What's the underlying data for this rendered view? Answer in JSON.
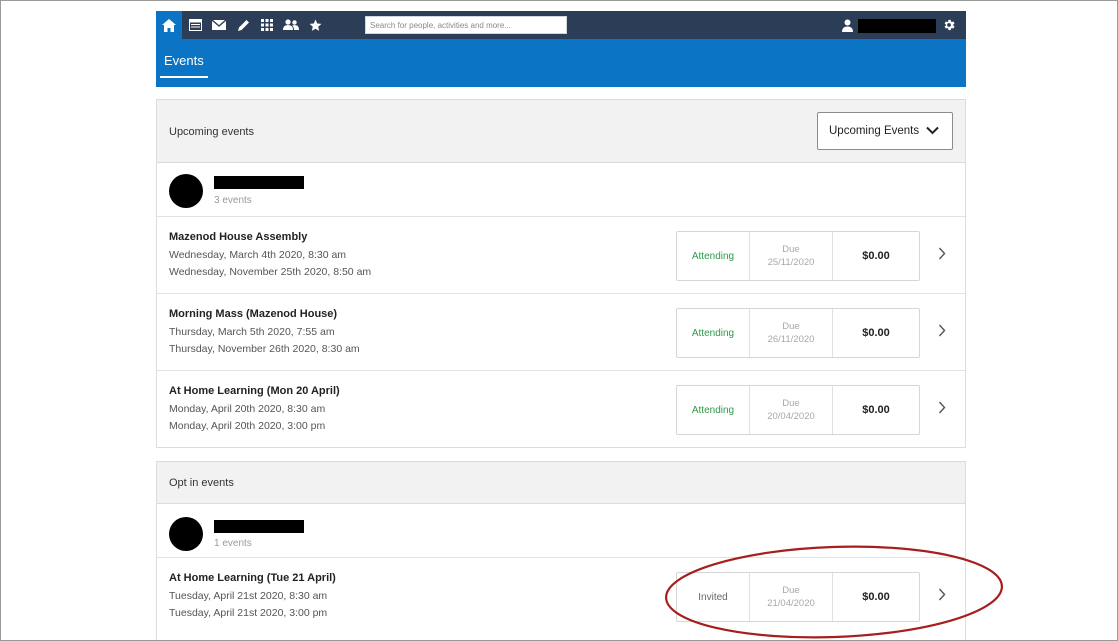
{
  "toolbar": {
    "search_placeholder": "Search for people, activities and more...",
    "icons": [
      "home-icon",
      "calendar-icon",
      "mail-icon",
      "pencil-icon",
      "grid-icon",
      "people-icon",
      "star-icon"
    ],
    "user_icon": "user-icon",
    "settings_icon": "gear-icon"
  },
  "header": {
    "tab_label": "Events"
  },
  "upcoming": {
    "title": "Upcoming events",
    "filter_label": "Upcoming Events",
    "group": {
      "count_label": "3 events"
    },
    "events": [
      {
        "title": "Mazenod House Assembly",
        "date_start": "Wednesday, March 4th 2020, 8:30 am",
        "date_end": "Wednesday, November 25th 2020, 8:50 am",
        "status": "Attending",
        "due_label": "Due",
        "due_date": "25/11/2020",
        "amount": "$0.00"
      },
      {
        "title": "Morning Mass (Mazenod House)",
        "date_start": "Thursday, March 5th 2020, 7:55 am",
        "date_end": "Thursday, November 26th 2020, 8:30 am",
        "status": "Attending",
        "due_label": "Due",
        "due_date": "26/11/2020",
        "amount": "$0.00"
      },
      {
        "title": "At Home Learning (Mon 20 April)",
        "date_start": "Monday, April 20th 2020, 8:30 am",
        "date_end": "Monday, April 20th 2020, 3:00 pm",
        "status": "Attending",
        "due_label": "Due",
        "due_date": "20/04/2020",
        "amount": "$0.00"
      }
    ]
  },
  "opt_in": {
    "title": "Opt in events",
    "group": {
      "count_label": "1 events"
    },
    "events": [
      {
        "title": "At Home Learning (Tue 21 April)",
        "date_start": "Tuesday, April 21st 2020, 8:30 am",
        "date_end": "Tuesday, April 21st 2020, 3:00 pm",
        "status": "Invited",
        "due_label": "Due",
        "due_date": "21/04/2020",
        "amount": "$0.00"
      }
    ]
  },
  "colors": {
    "toolbar_bg": "#2c3e57",
    "header_bg": "#0b74c4",
    "attending": "#2e9a48",
    "annotation": "#a51f1f"
  }
}
